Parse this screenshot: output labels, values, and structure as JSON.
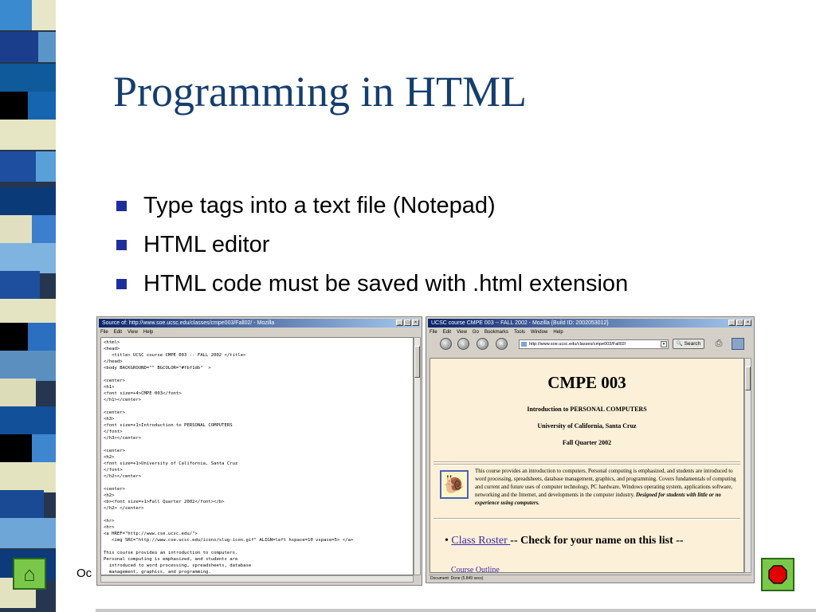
{
  "slide": {
    "title": "Programming in HTML",
    "bullets": [
      "Type tags into a text file (Notepad)",
      "HTML editor",
      "HTML code must be saved with .html extension"
    ],
    "footer_text": "Oc",
    "colors": {
      "title": "#153e6e",
      "bullet_square": "#1e2f9d",
      "nav_button_green": "#7ac84a",
      "stop_red": "#e00000"
    },
    "nav": {
      "home_icon": "home-icon",
      "stop_icon": "stop-icon"
    }
  },
  "source_window": {
    "title": "Source of: http://www.soe.ucsc.edu/classes/cmpe003/Fall02/ - Mozilla",
    "menu": [
      "File",
      "Edit",
      "View",
      "Help"
    ],
    "lines": [
      "<html>",
      "<head>",
      "   <title> UCSC course CMPE 003 -- FALL 2002 </title>",
      "</head>",
      "<body BACKGROUND=\"\" BGCOLOR=\"#fbf1db\"  >",
      "",
      "<center>",
      "<h1>",
      "<font size=+4>CMPE 003</font>",
      "</h1></center>",
      "",
      "<center>",
      "<h3>",
      "<font size=+1>Introduction to PERSONAL COMPUTERS",
      "</font>",
      "</h3></center>",
      "",
      "<center>",
      "<h2>",
      "<font size=+1>University of California, Santa Cruz",
      "</font>",
      "</h2></center>",
      "",
      "<center>",
      "<h2>",
      "<b><font size=+1>Fall Quarter 2002</font></b>",
      "</h2> </center>",
      "",
      "<hr>",
      "<hr>",
      "<a HREF=\"http://www.cse.ucsc.edu/\">",
      "   <img SRC=\"http://www.cse.ucsc.edu/icons/slug-icon.gif\" ALIGN=left hspace=10 vspace=5> </a>",
      "",
      "This course provides an introduction to computers.",
      "Personal computing is emphasized, and students are",
      "  introduced to word processing, spreadsheets, database",
      "  management, graphics, and programming."
    ]
  },
  "browser_window": {
    "title": "UCSC course CMPE 003 -- FALL 2002 - Mozilla {Build ID: 2002053012}",
    "menu": [
      "File",
      "Edit",
      "View",
      "Go",
      "Bookmarks",
      "Tools",
      "Window",
      "Help"
    ],
    "url": "http://www.soe.ucsc.edu/classes/cmpe003/Fall02/",
    "search_label": "Search",
    "status": "Document: Done (5.849 secs)",
    "page": {
      "heading": "CMPE 003",
      "subheading": "Introduction to PERSONAL COMPUTERS",
      "university": "University of California, Santa Cruz",
      "quarter": "Fall Quarter 2002",
      "description": "This course provides an introduction to computers. Personal computing is emphasized, and students are introduced to word processing, spreadsheets, database management, graphics, and programming. Covers fundamentals of computing and current and future uses of computer technology, PC hardware, Windows operating system, applications software, networking and the Internet, and developments in the computer industry.",
      "description_emphasis": "Designed for students with little or no experience using computers.",
      "roster_link": "Class Roster ",
      "roster_text": "-- Check for your name on this list --",
      "outline_link": "Course Outline"
    }
  }
}
